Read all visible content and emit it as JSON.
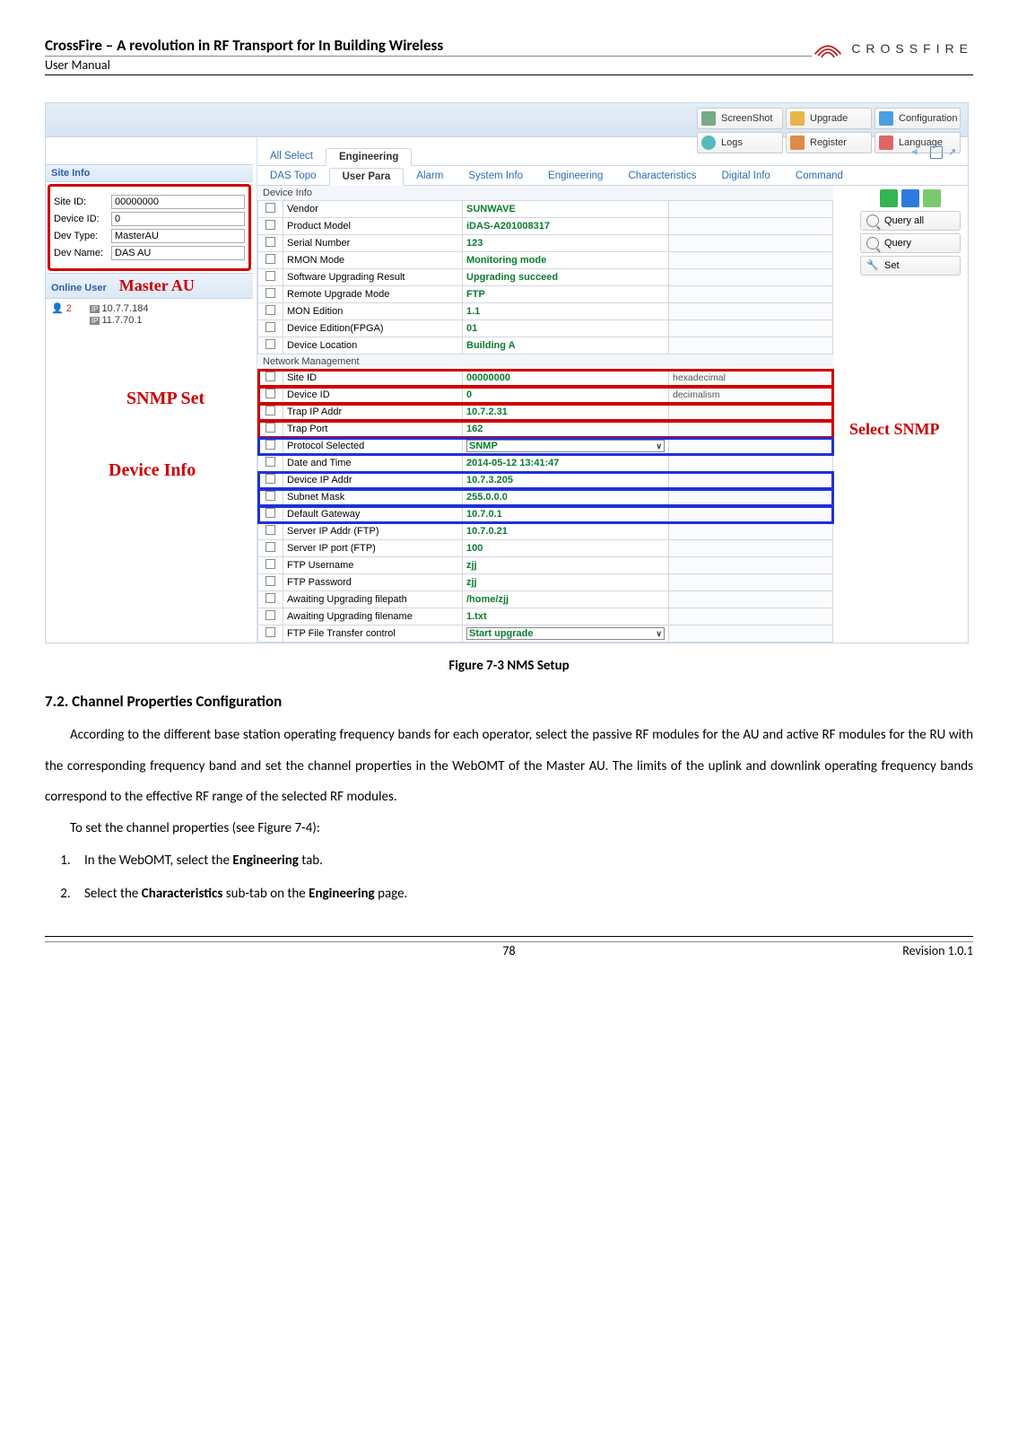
{
  "doc": {
    "title": "CrossFire – A revolution in RF Transport for In Building Wireless",
    "subtitle": "User Manual",
    "brand": "CROSSFIRE",
    "page_number": "78",
    "revision": "Revision 1.0.1"
  },
  "figure_caption": "Figure 7-3 NMS Setup",
  "section_heading": "7.2. Channel Properties Configuration",
  "paragraph1": "According to the different base station operating frequency bands for each operator, select the passive RF modules for the AU and active RF modules for the RU with the corresponding frequency band and set the channel properties in the WebOMT of the Master AU. The limits of the uplink and downlink operating frequency bands correspond to the effective RF range of the selected RF modules.",
  "paragraph2": "To set the channel properties (see Figure 7-4):",
  "steps": {
    "s1_pre": "In the WebOMT, select the ",
    "s1_bold": "Engineering",
    "s1_post": " tab.",
    "s2_pre": "Select the ",
    "s2_bold1": "Characteristics",
    "s2_mid": " sub-tab on the ",
    "s2_bold2": "Engineering",
    "s2_post": " page."
  },
  "toolbar": {
    "screenshot": "ScreenShot",
    "upgrade": "Upgrade",
    "configuration": "Configuration",
    "logs": "Logs",
    "register": "Register",
    "language": "Language"
  },
  "site_info": {
    "header": "Site Info",
    "site_id_lbl": "Site ID:",
    "site_id_val": "00000000",
    "device_id_lbl": "Device ID:",
    "device_id_val": "0",
    "dev_type_lbl": "Dev Type:",
    "dev_type_val": "MasterAU",
    "dev_name_lbl": "Dev Name:",
    "dev_name_val": "DAS AU"
  },
  "online_user": {
    "header": "Online User",
    "master_au": "Master AU",
    "count": "2",
    "ip1": "10.7.7.184",
    "ip2": "11.7.70.1"
  },
  "annotations": {
    "snmp_set": "SNMP Set",
    "device_info": "Device Info",
    "select_snmp": "Select SNMP"
  },
  "tabs1": {
    "all_select": "All Select",
    "engineering": "Engineering"
  },
  "tabs2": {
    "das_topo": "DAS Topo",
    "user_para": "User Para",
    "alarm": "Alarm",
    "system_info": "System Info",
    "engineering": "Engineering",
    "characteristics": "Characteristics",
    "digital_info": "Digital Info",
    "command": "Command"
  },
  "side_buttons": {
    "query_all": "Query all",
    "query": "Query",
    "set": "Set"
  },
  "sections": {
    "device_info": "Device Info",
    "network_mgmt": "Network Management"
  },
  "device_info_rows": [
    {
      "param": "Vendor",
      "val": "SUNWAVE"
    },
    {
      "param": "Product Model",
      "val": "iDAS-A201008317"
    },
    {
      "param": "Serial Number",
      "val": "123"
    },
    {
      "param": "RMON Mode",
      "val": "Monitoring mode"
    },
    {
      "param": "Software Upgrading Result",
      "val": "Upgrading succeed"
    },
    {
      "param": "Remote Upgrade Mode",
      "val": "FTP"
    },
    {
      "param": "MON Edition",
      "val": "1.1"
    },
    {
      "param": "Device Edition(FPGA)",
      "val": "01"
    },
    {
      "param": "Device Location",
      "val": "Building A"
    }
  ],
  "network_rows": [
    {
      "param": "Site ID",
      "val": "00000000",
      "note": "hexadecimal"
    },
    {
      "param": "Device ID",
      "val": "0",
      "note": "decimalism"
    },
    {
      "param": "Trap IP Addr",
      "val": "10.7.2.31",
      "note": ""
    },
    {
      "param": "Trap Port",
      "val": "162",
      "note": ""
    },
    {
      "param": "Protocol Selected",
      "val": "SNMP",
      "note": ""
    },
    {
      "param": "Date and Time",
      "val": "2014-05-12 13:41:47",
      "note": ""
    },
    {
      "param": "Device IP Addr",
      "val": "10.7.3.205",
      "note": ""
    },
    {
      "param": "Subnet Mask",
      "val": "255.0.0.0",
      "note": ""
    },
    {
      "param": "Default Gateway",
      "val": "10.7.0.1",
      "note": ""
    },
    {
      "param": "Server IP Addr (FTP)",
      "val": "10.7.0.21",
      "note": ""
    },
    {
      "param": "Server IP port (FTP)",
      "val": "100",
      "note": ""
    },
    {
      "param": "FTP Username",
      "val": "zjj",
      "note": ""
    },
    {
      "param": "FTP Password",
      "val": "zjj",
      "note": ""
    },
    {
      "param": "Awaiting Upgrading filepath",
      "val": "/home/zjj",
      "note": ""
    },
    {
      "param": "Awaiting Upgrading filename",
      "val": "1.txt",
      "note": ""
    },
    {
      "param": "FTP File Transfer control",
      "val": "Start upgrade",
      "note": ""
    }
  ]
}
